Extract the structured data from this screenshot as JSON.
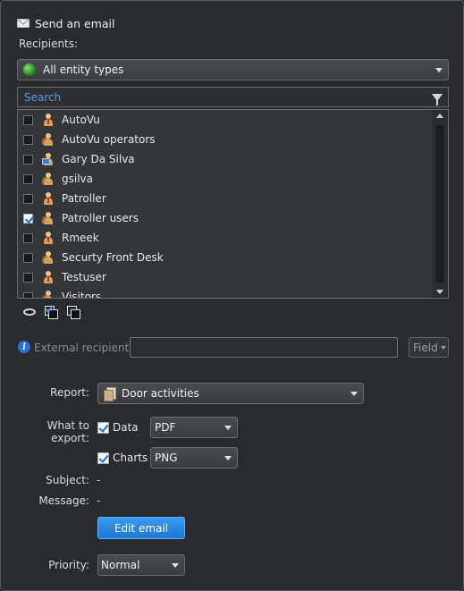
{
  "dialog": {
    "title": "Send an email"
  },
  "recipients": {
    "label": "Recipients:",
    "entity_filter": "All entity types",
    "search_placeholder": "Search",
    "items": [
      {
        "label": "AutoVu",
        "checked": false,
        "icon": "user-icon"
      },
      {
        "label": "AutoVu operators",
        "checked": false,
        "icon": "user-group-icon"
      },
      {
        "label": "Gary Da Silva",
        "checked": false,
        "icon": "cardholder-icon"
      },
      {
        "label": "gsilva",
        "checked": false,
        "icon": "user-group-icon"
      },
      {
        "label": "Patroller",
        "checked": false,
        "icon": "user-icon"
      },
      {
        "label": "Patroller users",
        "checked": true,
        "icon": "user-group-icon"
      },
      {
        "label": "Rmeek",
        "checked": false,
        "icon": "user-icon"
      },
      {
        "label": "Securty Front Desk",
        "checked": false,
        "icon": "user-group-icon"
      },
      {
        "label": "Testuser",
        "checked": false,
        "icon": "user-icon"
      },
      {
        "label": "Visitors",
        "checked": false,
        "icon": "user-group-icon"
      }
    ]
  },
  "external": {
    "label": "External recipients:",
    "value": "",
    "field_button": "Field"
  },
  "report": {
    "label": "Report:",
    "value": "Door activities"
  },
  "export": {
    "label": "What to export:",
    "data": {
      "label": "Data",
      "checked": true,
      "format": "PDF"
    },
    "charts": {
      "label": "Charts",
      "checked": true,
      "format": "PNG"
    }
  },
  "subject": {
    "label": "Subject:",
    "value": "-"
  },
  "message": {
    "label": "Message:",
    "value": "-"
  },
  "edit_email_button": "Edit email",
  "priority": {
    "label": "Priority:",
    "value": "Normal"
  },
  "colors": {
    "accent": "#1e78d4",
    "search_placeholder": "#4f9be0"
  }
}
